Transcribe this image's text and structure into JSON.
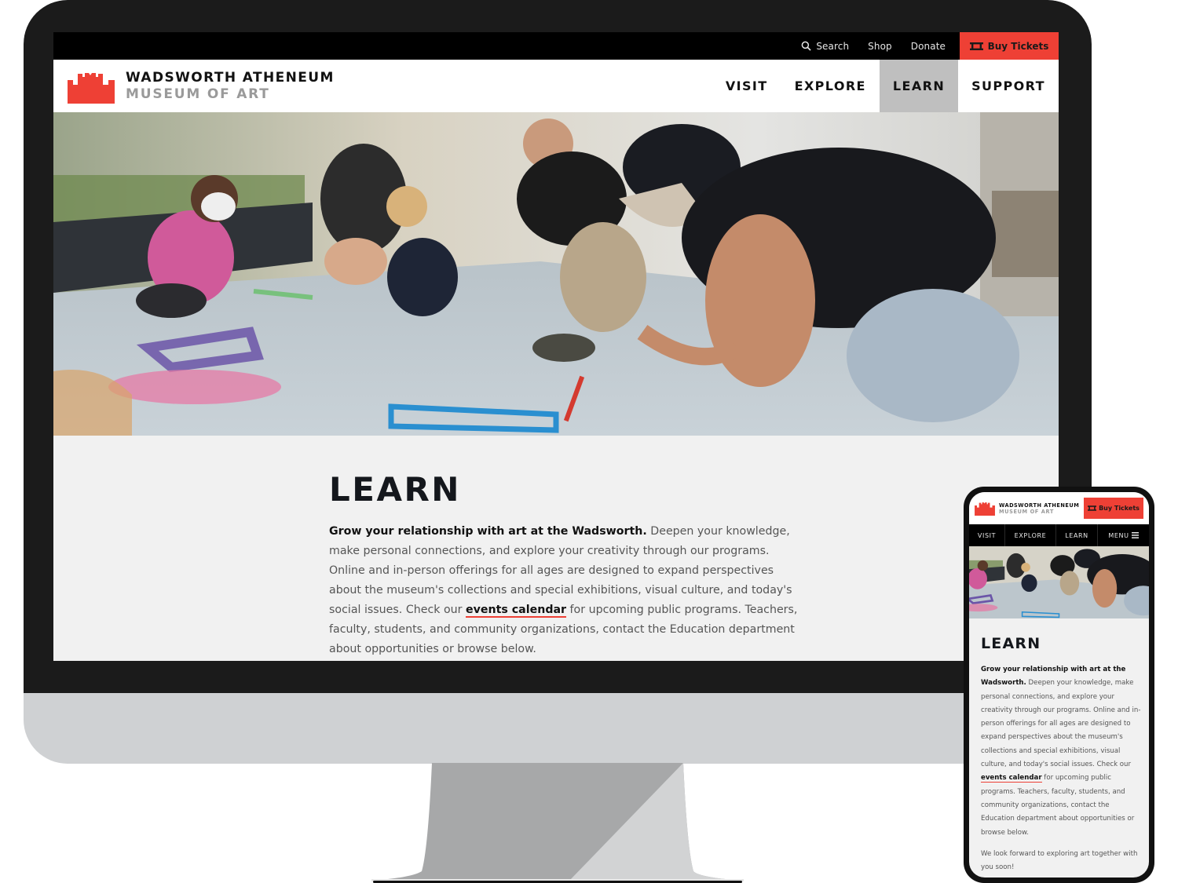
{
  "brand": {
    "name_line1": "WADSWORTH ATHENEUM",
    "name_line2": "MUSEUM OF ART",
    "accent_color": "#ee4035",
    "logo_icon": "castle-icon"
  },
  "utility_nav": {
    "search_label": "Search",
    "search_icon": "search-icon",
    "shop_label": "Shop",
    "donate_label": "Donate",
    "buy_tickets_label": "Buy Tickets",
    "ticket_icon": "ticket-icon"
  },
  "main_nav": {
    "items": [
      {
        "label": "VISIT",
        "active": false
      },
      {
        "label": "EXPLORE",
        "active": false
      },
      {
        "label": "LEARN",
        "active": true
      },
      {
        "label": "SUPPORT",
        "active": false
      }
    ]
  },
  "hero": {
    "alt": "Families painting on a sidewalk with chalk paint"
  },
  "page": {
    "title": "LEARN",
    "intro_bold": "Grow your relationship with art at the Wadsworth.",
    "intro_part1": " Deepen your knowledge, make personal connections, and explore your creativity through our programs. Online and in-person offerings for all ages are designed to expand perspectives about the museum's collections and special exhibitions, visual culture, and today's social issues. Check our ",
    "events_link": "events calendar",
    "intro_part2": " for upcoming public programs. Teachers, faculty, students, and community organizations, contact the Education department about opportunities or browse below.",
    "closing": "We look forward to exploring art together with you soon!"
  },
  "mobile": {
    "buy_tickets_label": "Buy Tickets",
    "nav": [
      "VISIT",
      "EXPLORE",
      "LEARN",
      "MENU"
    ],
    "menu_icon": "hamburger-icon"
  }
}
